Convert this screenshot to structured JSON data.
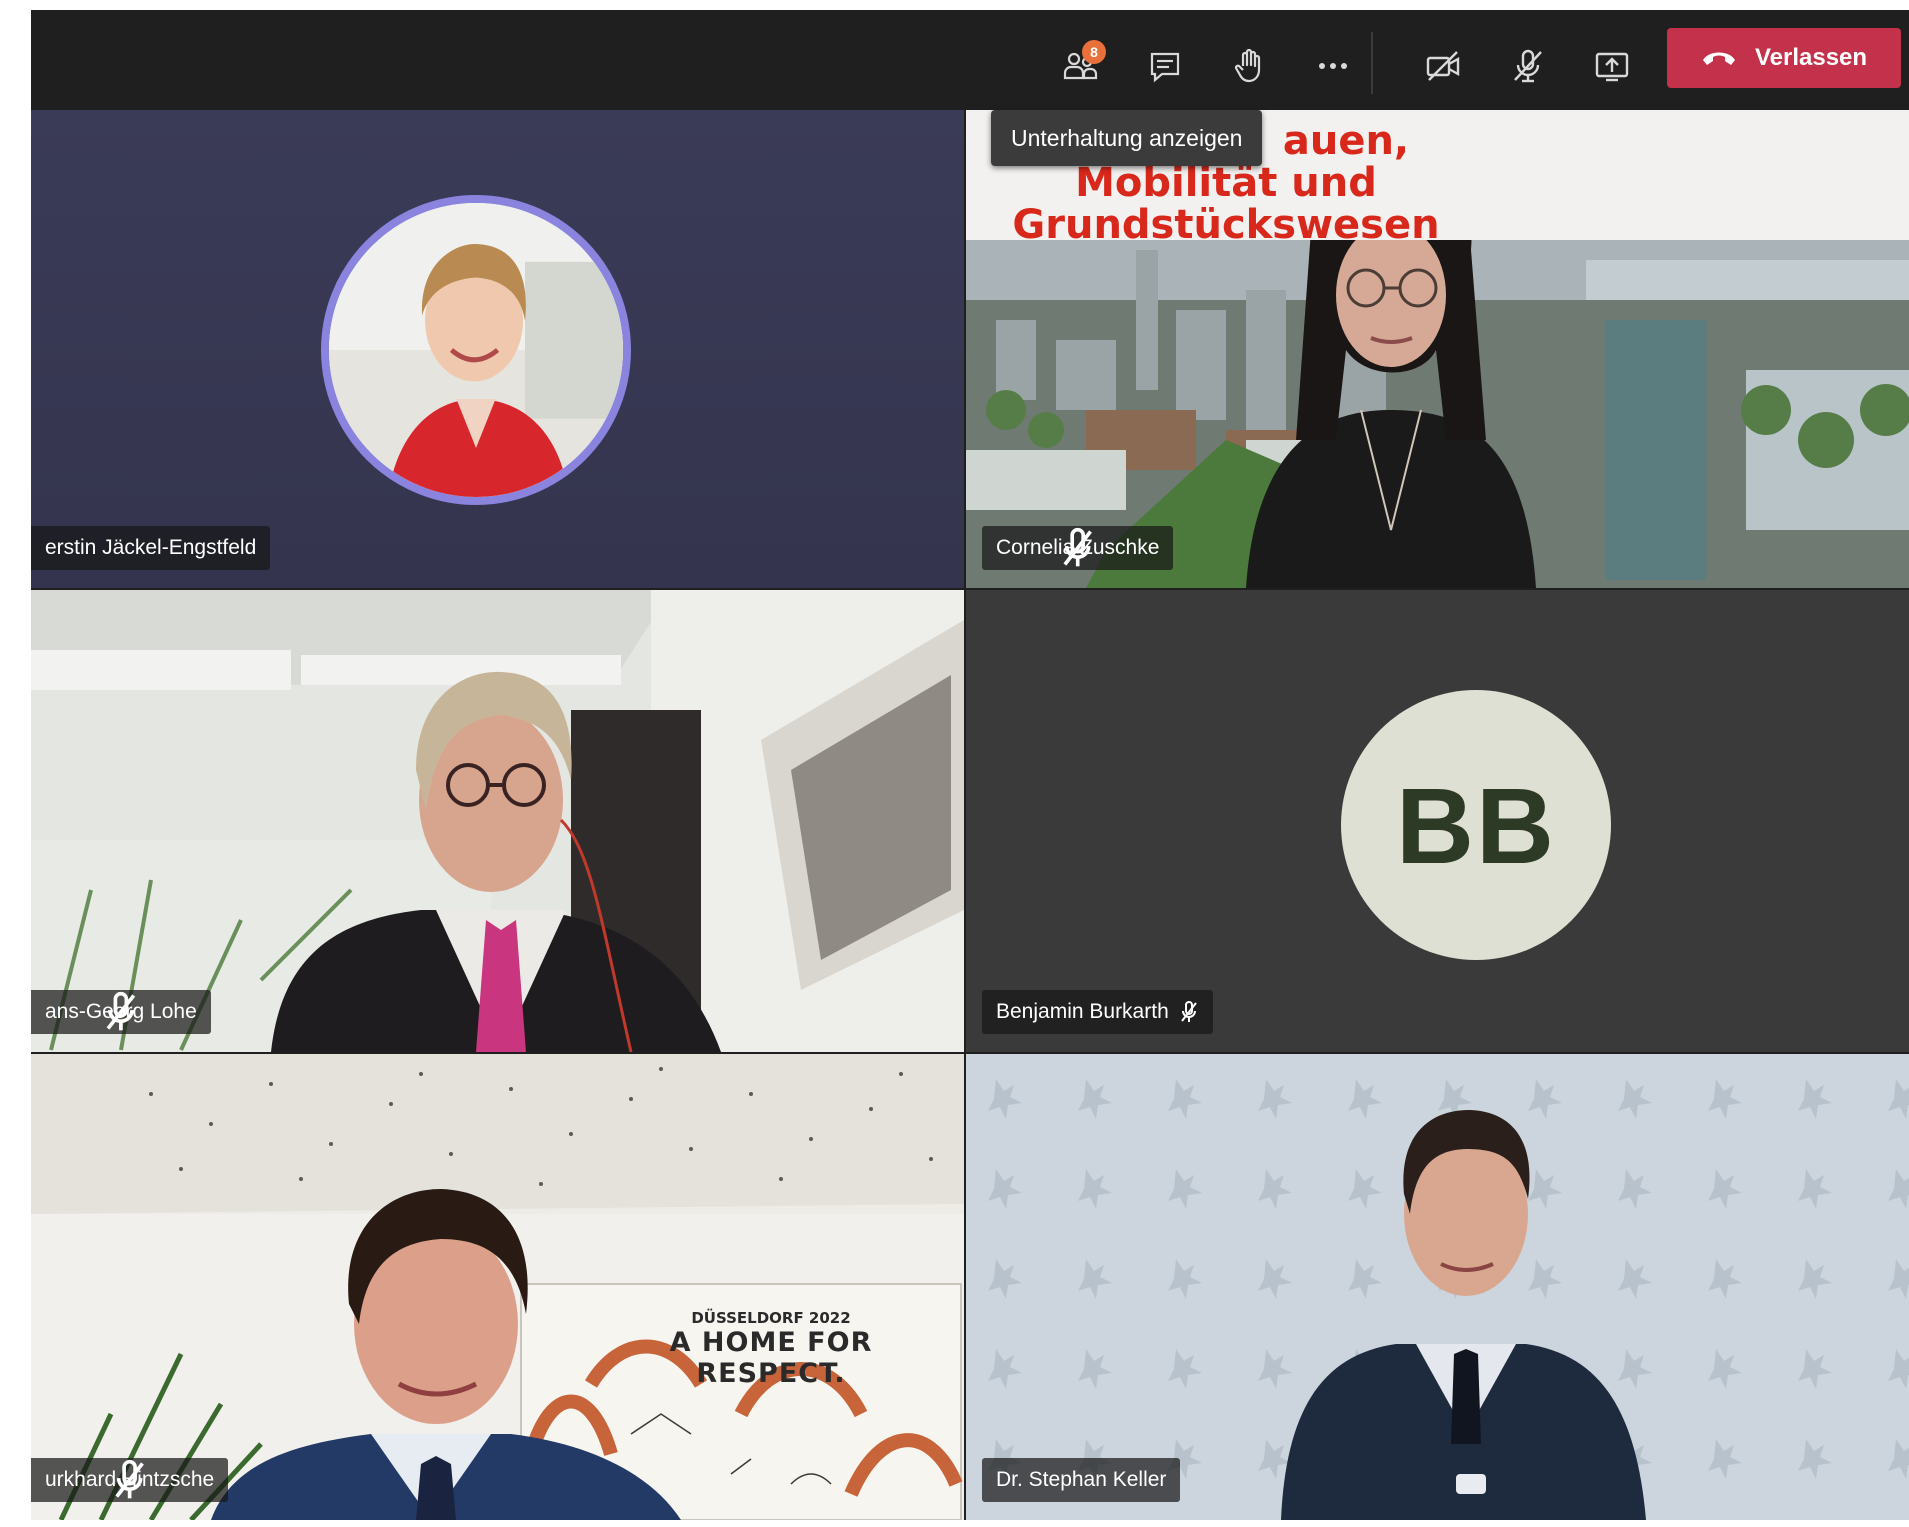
{
  "toolbar": {
    "participants_badge": "8",
    "leave_label": "Verlassen"
  },
  "tooltip": "Unterhaltung anzeigen",
  "tiles": {
    "t1": {
      "name": "erstin Jäckel-Engstfeld"
    },
    "t2": {
      "name": "Cornelia Zuschke",
      "banner_line1": "auen,",
      "banner_line2": "Mobilität und",
      "banner_line3": "Grundstückswesen"
    },
    "t3": {
      "name": "ans-Georg Lohe"
    },
    "t4": {
      "name": "Benjamin Burkarth",
      "initials": "BB"
    },
    "t5": {
      "name": "urkhard Hintzsche",
      "poster_line1": "DÜSSELDORF 2022",
      "poster_line2": "A HOME FOR RESPECT."
    },
    "t6": {
      "name": "Dr. Stephan Keller"
    }
  },
  "colors": {
    "toolbar_bg": "#1f1f1f",
    "leave_red": "#c4314b",
    "avatar_ring": "#8a84de",
    "badge_orange": "#e8703a",
    "banner_red": "#d8281c"
  },
  "icons": [
    "participants-icon",
    "chat-icon",
    "raise-hand-icon",
    "more-icon",
    "camera-off-icon",
    "mic-off-icon",
    "share-screen-icon",
    "phone-hangup-icon",
    "mic-muted-small-icon"
  ]
}
